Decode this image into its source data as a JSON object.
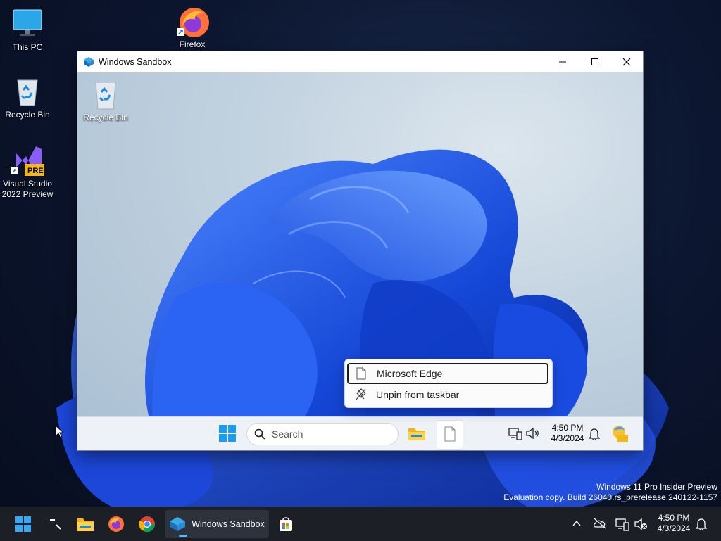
{
  "desktop": {
    "icons": [
      {
        "label": "This PC"
      },
      {
        "label": "Recycle Bin"
      },
      {
        "label": "Visual Studio 2022 Preview"
      },
      {
        "label": "Firefox"
      }
    ],
    "watermark": {
      "line1": "Windows 11 Pro Insider Preview",
      "line2": "Evaluation copy. Build 26040.rs_prerelease.240122-1157"
    }
  },
  "sandbox_window": {
    "title": "Windows Sandbox",
    "inner_desktop": {
      "icon_label": "Recycle Bin"
    },
    "inner_taskbar": {
      "search_placeholder": "Search",
      "time": "4:50 PM",
      "date": "4/3/2024"
    },
    "context_menu": {
      "items": [
        {
          "label": "Microsoft Edge",
          "selected": true
        },
        {
          "label": "Unpin from taskbar",
          "selected": false
        }
      ]
    }
  },
  "taskbar": {
    "active_app_label": "Windows Sandbox",
    "time": "4:50 PM",
    "date": "4/3/2024",
    "accent": "#4cc2ff"
  },
  "icons": {
    "vs_badge": "PRE"
  }
}
